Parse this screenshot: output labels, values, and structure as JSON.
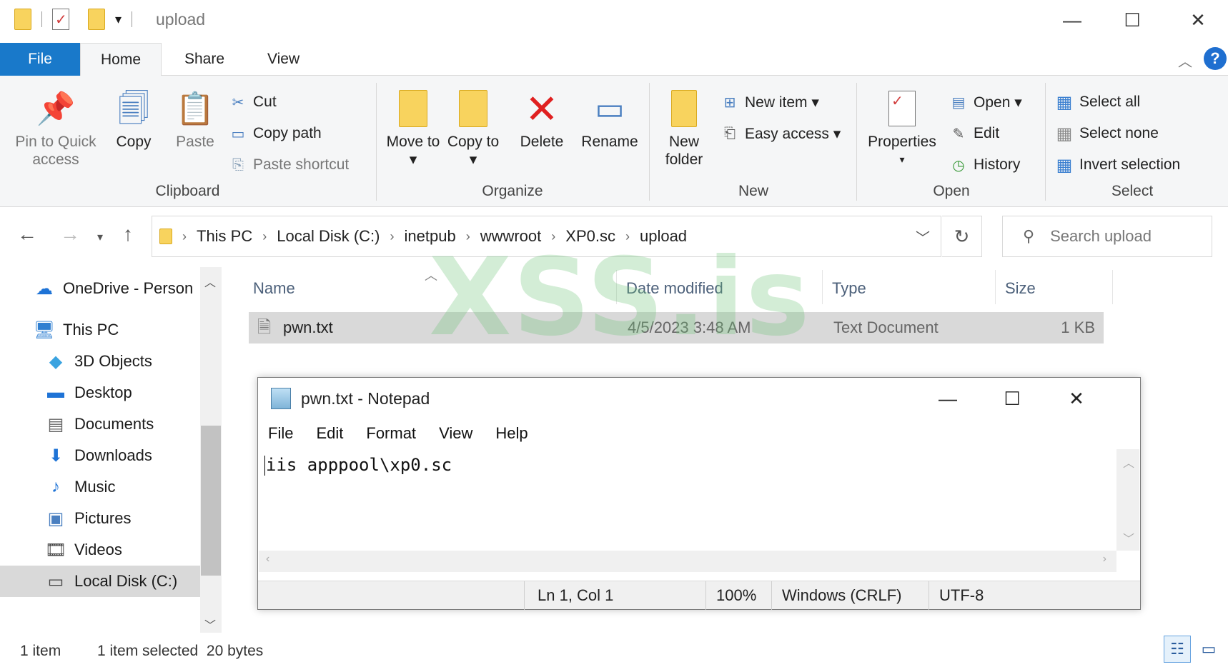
{
  "window": {
    "title": "upload",
    "minimize": "—",
    "maximize": "☐",
    "close": "✕"
  },
  "tabs": {
    "file": "File",
    "home": "Home",
    "share": "Share",
    "view": "View",
    "help": "?"
  },
  "ribbon": {
    "clipboard": {
      "label": "Clipboard",
      "pin": "Pin to Quick access",
      "copy": "Copy",
      "paste": "Paste",
      "cut": "Cut",
      "copy_path": "Copy path",
      "paste_shortcut": "Paste shortcut"
    },
    "organize": {
      "label": "Organize",
      "move_to": "Move to ▾",
      "copy_to": "Copy to ▾",
      "delete": "Delete",
      "rename": "Rename"
    },
    "new": {
      "label": "New",
      "new_folder": "New folder",
      "new_item": "New item ▾",
      "easy_access": "Easy access ▾"
    },
    "open": {
      "label": "Open",
      "properties": "Properties",
      "open": "Open ▾",
      "edit": "Edit",
      "history": "History"
    },
    "select": {
      "label": "Select",
      "select_all": "Select all",
      "select_none": "Select none",
      "invert": "Invert selection"
    }
  },
  "address": {
    "crumbs": [
      "This PC",
      "Local Disk (C:)",
      "inetpub",
      "wwwroot",
      "XP0.sc",
      "upload"
    ],
    "search_placeholder": "Search upload"
  },
  "sidebar": {
    "items": [
      {
        "label": "OneDrive - Person",
        "icon": "cloud-icon"
      },
      {
        "label": "This PC",
        "icon": "monitor-icon"
      },
      {
        "label": "3D Objects",
        "icon": "cube-icon"
      },
      {
        "label": "Desktop",
        "icon": "desktop-icon"
      },
      {
        "label": "Documents",
        "icon": "document-icon"
      },
      {
        "label": "Downloads",
        "icon": "download-icon"
      },
      {
        "label": "Music",
        "icon": "music-icon"
      },
      {
        "label": "Pictures",
        "icon": "picture-icon"
      },
      {
        "label": "Videos",
        "icon": "video-icon"
      },
      {
        "label": "Local Disk (C:)",
        "icon": "drive-icon"
      }
    ]
  },
  "filelist": {
    "columns": {
      "name": "Name",
      "date": "Date modified",
      "type": "Type",
      "size": "Size"
    },
    "rows": [
      {
        "name": "pwn.txt",
        "date": "4/5/2023 3:48 AM",
        "type": "Text Document",
        "size": "1 KB"
      }
    ]
  },
  "watermark": "XSS.is",
  "notepad": {
    "title": "pwn.txt - Notepad",
    "menu": [
      "File",
      "Edit",
      "Format",
      "View",
      "Help"
    ],
    "content": "iis apppool\\xp0.sc",
    "status": {
      "position": "Ln 1, Col 1",
      "zoom": "100%",
      "line_ending": "Windows (CRLF)",
      "encoding": "UTF-8"
    }
  },
  "statusbar": {
    "count": "1 item",
    "selected": "1 item selected  20 bytes"
  },
  "colors": {
    "accent": "#1979ca",
    "selection": "#d9d9d9",
    "folder": "#f8d35e",
    "delete": "#e02020"
  }
}
